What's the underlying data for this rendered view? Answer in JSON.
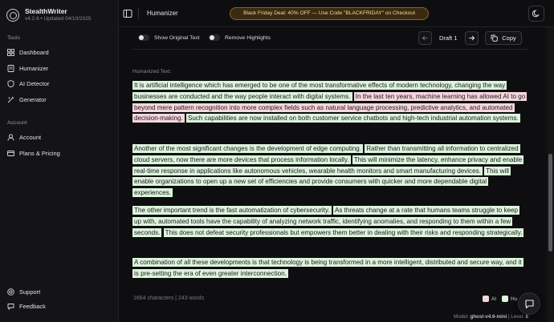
{
  "brand": {
    "name": "StealthWriter",
    "version": "v4.2.6 • Updated 04/10/2025"
  },
  "sidebar": {
    "tools_label": "Tools",
    "tools": [
      {
        "label": "Dashboard",
        "icon": "dashboard-icon"
      },
      {
        "label": "Humanizer",
        "icon": "humanizer-icon"
      },
      {
        "label": "AI Detector",
        "icon": "ai-detector-icon"
      },
      {
        "label": "Generator",
        "icon": "generator-icon"
      }
    ],
    "account_label": "Account",
    "account": [
      {
        "label": "Account",
        "icon": "user-icon"
      },
      {
        "label": "Plans & Pricing",
        "icon": "card-icon"
      }
    ],
    "bottom": [
      {
        "label": "Support",
        "icon": "support-icon"
      },
      {
        "label": "Feedback",
        "icon": "feedback-icon"
      }
    ]
  },
  "header": {
    "title": "Humanizer",
    "promo": "Black Friday Deal: 40% OFF — Use Code \"BLACKFRIDAY\" on Checkout"
  },
  "controls": {
    "show_original": "Show Original Text",
    "remove_highlights": "Remove Highlights",
    "draft": "Draft 1",
    "copy": "Copy"
  },
  "content": {
    "label": "Humanized Text:",
    "paragraphs": [
      [
        {
          "text": "It is artificial intelligence which has emerged to be one of the most transformative effects of modern technology, changing the way businesses are conducted and the way people interact with digital systems.",
          "type": "human"
        },
        {
          "text": "In the last ten years, machine learning has allowed AI to go beyond mere pattern recognition into more complex fields such as natural language processing, predictive analytics, and automated decision-making.",
          "type": "ai"
        },
        {
          "text": "Such capabilities are now installed on both customer service chatbots and high-tech industrial automation systems.",
          "type": "human"
        }
      ],
      [
        {
          "text": "Another of the most significant changes is the development of edge computing.",
          "type": "human"
        },
        {
          "text": "Rather than transmitting all information to centralized cloud servers, now there are more devices that process information locally.",
          "type": "human"
        },
        {
          "text": "This will minimize the latency, enhance privacy and enable real-time response in applications like autonomous vehicles, wearable health monitors and smart manufacturing devices.",
          "type": "human"
        },
        {
          "text": "This will enable organizations to open up a new set of efficiencies and provide consumers with quicker and more dependable digital experiences.",
          "type": "human"
        }
      ],
      [
        {
          "text": "The other important trend is the fast automatization of cybersecurity.",
          "type": "human"
        },
        {
          "text": "As threats change at a rate that humans teams struggle to keep up with, automated tools have the capability of analyzing network traffic, identifying anomalies, and responding to them within a few seconds.",
          "type": "human"
        },
        {
          "text": "This does not defeat security professionals but empowers them better in dealing with their risks and responding strategically.",
          "type": "human"
        }
      ],
      [
        {
          "text": "A combination of all these developments is that technology is being transformed in a more intelligent, distributed and secure way, and it is pre-setting the era of even greater interconnection.",
          "type": "human"
        }
      ]
    ]
  },
  "stats": "1664 characters | 243 words",
  "legend": {
    "ai": "AI",
    "human": "Hu",
    "ai_color": "#f6d6dd",
    "human_color": "#dcf3dc"
  },
  "model": {
    "label": "Model:",
    "name": "ghost-v4.6-mini",
    "level_label": "Level:",
    "level": "8"
  }
}
